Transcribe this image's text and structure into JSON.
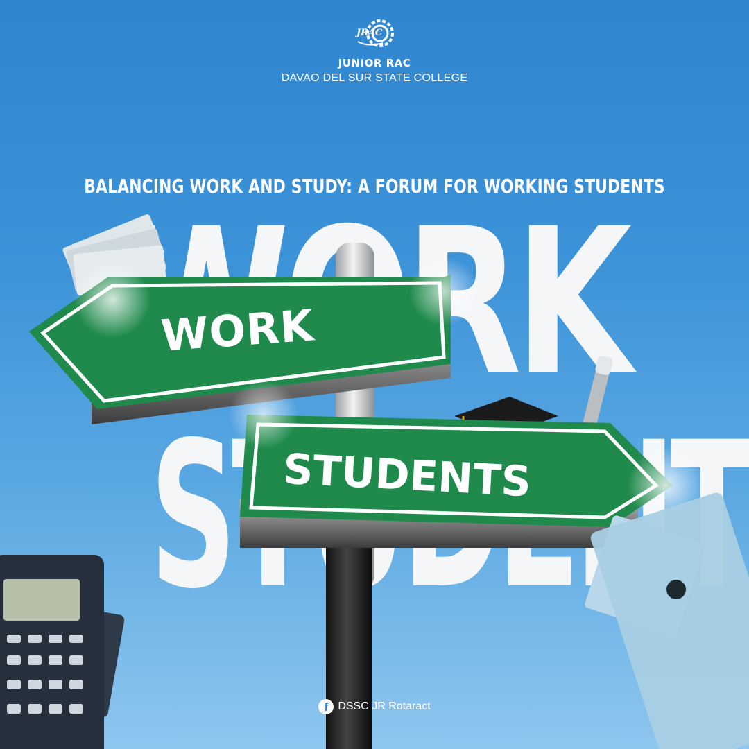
{
  "header": {
    "logo_icon": "jrac-gear-logo-icon",
    "logo_text": "JRAC",
    "org_name": "JUNIOR RAC",
    "college": "DAVAO DEL SUR STATE COLLEGE"
  },
  "forum_title": "BALANCING WORK AND STUDY: A FORUM FOR WORKING STUDENTS",
  "background_words": {
    "top": "WORK",
    "bottom": "STUDENTS"
  },
  "signs": {
    "left": "WORK",
    "right": "STUDENTS",
    "color": "#1f8a4c"
  },
  "footer": {
    "icon": "facebook-icon",
    "label": "DSSC JR Rotaract"
  },
  "colors": {
    "sky_top": "#2f86cf",
    "sky_bottom": "#8ec6ee",
    "text": "#ffffff"
  }
}
